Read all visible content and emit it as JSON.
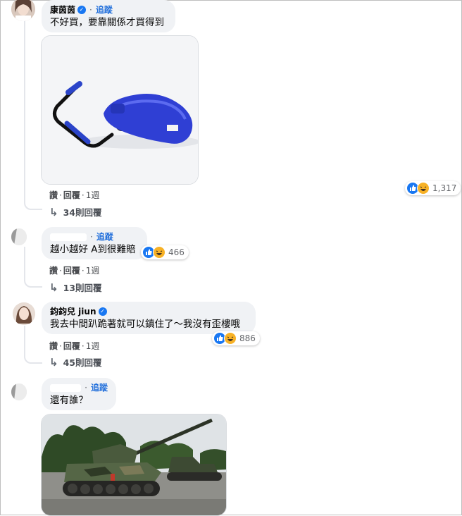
{
  "comments": [
    {
      "author": "康茵茵",
      "verified": true,
      "follow_label": "追蹤",
      "text": "不好買，要靠關係才買得到",
      "attachment": "flying-turtle-scooter-image",
      "actions": {
        "like": "讚",
        "reply": "回覆",
        "time": "1週"
      },
      "reactions": {
        "types": [
          "like",
          "haha"
        ],
        "count": "1,317"
      },
      "replies_label": "34則回覆"
    },
    {
      "author": "",
      "verified": false,
      "follow_label": "追蹤",
      "text": "越小越好 A到很難賠",
      "actions": {
        "like": "讚",
        "reply": "回覆",
        "time": "1週"
      },
      "reactions": {
        "types": [
          "like",
          "haha"
        ],
        "count": "466"
      },
      "replies_label": "13則回覆"
    },
    {
      "author": "鈞鈞兒 jiun",
      "verified": true,
      "text": "我去中間趴跪著就可以鎮住了～我沒有歪樓哦",
      "actions": {
        "like": "讚",
        "reply": "回覆",
        "time": "1週"
      },
      "reactions": {
        "types": [
          "like",
          "haha"
        ],
        "count": "886"
      },
      "replies_label": "45則回覆"
    },
    {
      "author": "",
      "verified": false,
      "follow_label": "追蹤",
      "text": "還有誰？",
      "attachment": "army-tank-image"
    }
  ],
  "colors": {
    "bubble": "#f0f2f5",
    "link": "#216fdb",
    "like": "#1877f2",
    "haha": "#f7b125",
    "muted": "#65676b"
  }
}
